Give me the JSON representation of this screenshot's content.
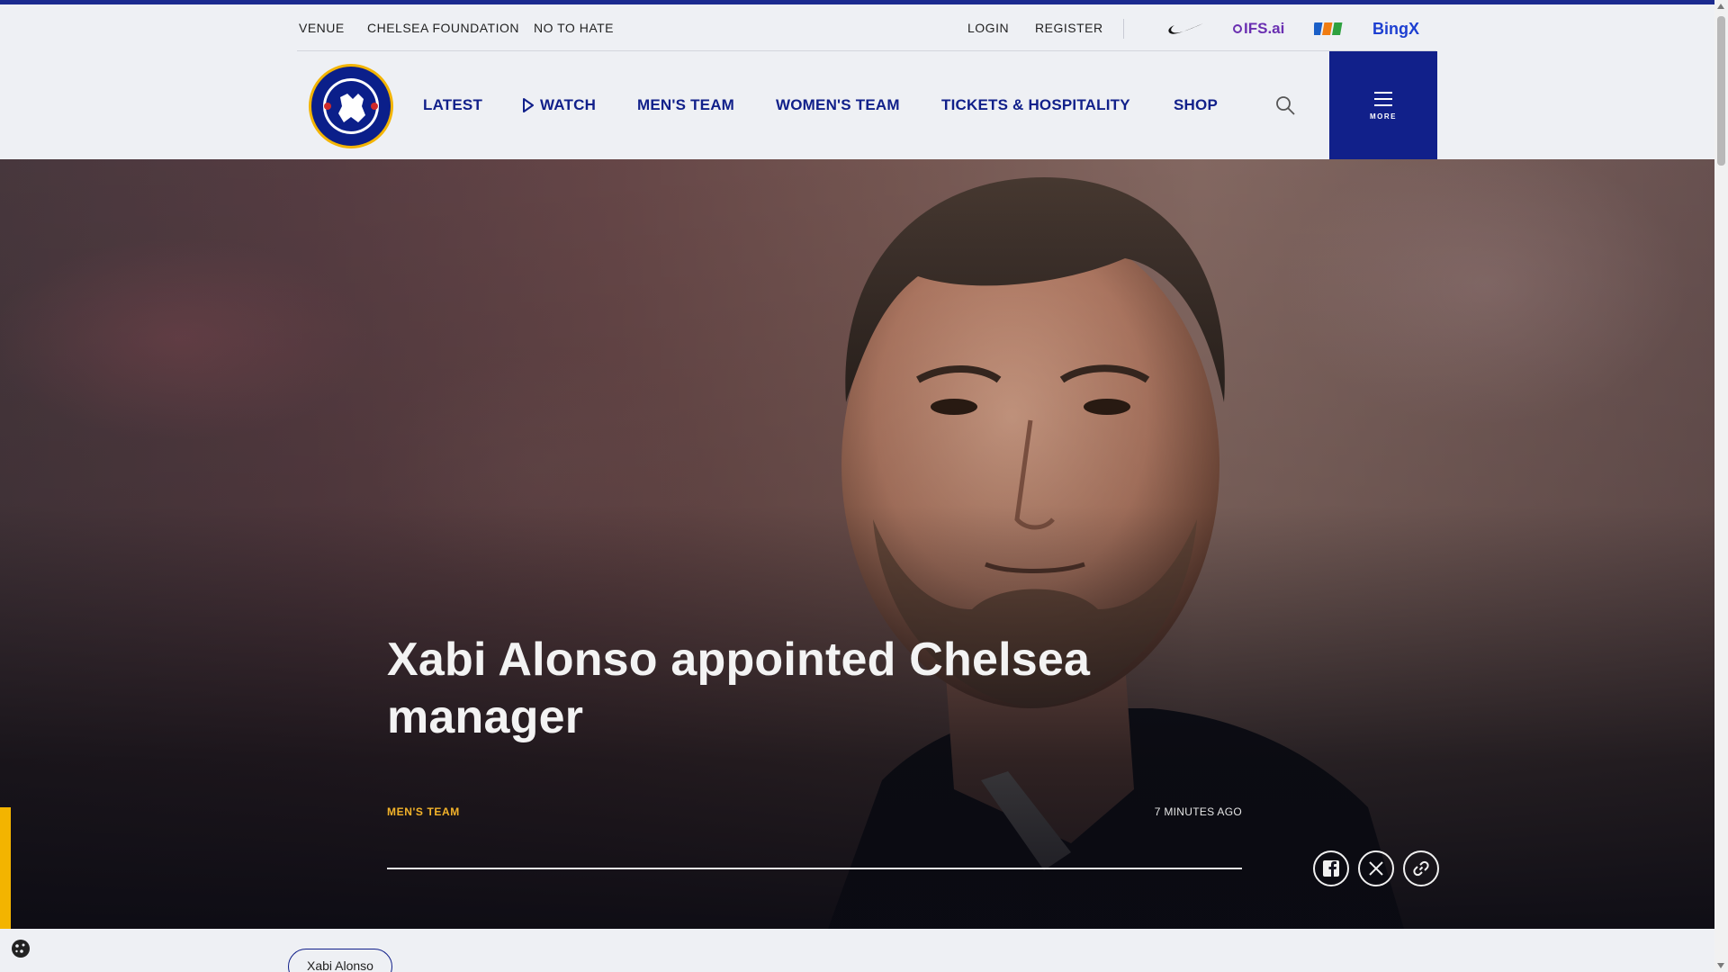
{
  "utility_nav": {
    "left_links": [
      "VENUE",
      "CHELSEA FOUNDATION",
      "NO TO HATE"
    ],
    "login": "LOGIN",
    "register": "REGISTER",
    "partners": {
      "ifs": "IFS.ai",
      "fpt": "FPT",
      "bingx": "BingX"
    }
  },
  "main_nav": {
    "items": [
      "LATEST",
      "WATCH",
      "MEN'S TEAM",
      "WOMEN'S TEAM",
      "TICKETS & HOSPITALITY",
      "SHOP"
    ],
    "more_label": "MORE"
  },
  "colors": {
    "brand_blue": "#11208a",
    "accent_yellow": "#f3b32a"
  },
  "article": {
    "headline": "Xabi Alonso appointed Chelsea manager",
    "category": "MEN'S TEAM",
    "time": "7 MINUTES AGO"
  },
  "tags": [
    "Xabi Alonso"
  ]
}
